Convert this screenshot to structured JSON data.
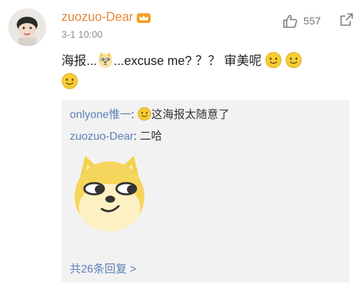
{
  "post": {
    "username": "zuozuo-Dear",
    "timestamp": "3-1 10:00",
    "likes": "557",
    "content_part1": "海报...",
    "content_part2": "...excuse me? ？？ 审美呢"
  },
  "replies": [
    {
      "user": "onlyone惟一",
      "sep": ":",
      "text": "这海报太随意了"
    },
    {
      "user": "zuozuo-Dear",
      "sep": ":",
      "text": "二哈"
    }
  ],
  "more_replies": "共26条回复 >",
  "icons": {
    "like": "thumbs-up-icon",
    "share": "share-icon",
    "badge": "crown-badge-icon",
    "smile": "smile-emoji-icon",
    "doge": "doge-emoji-icon"
  },
  "colors": {
    "username": "#e7893c",
    "link": "#5b7fb8",
    "panel": "#f2f2f2"
  }
}
